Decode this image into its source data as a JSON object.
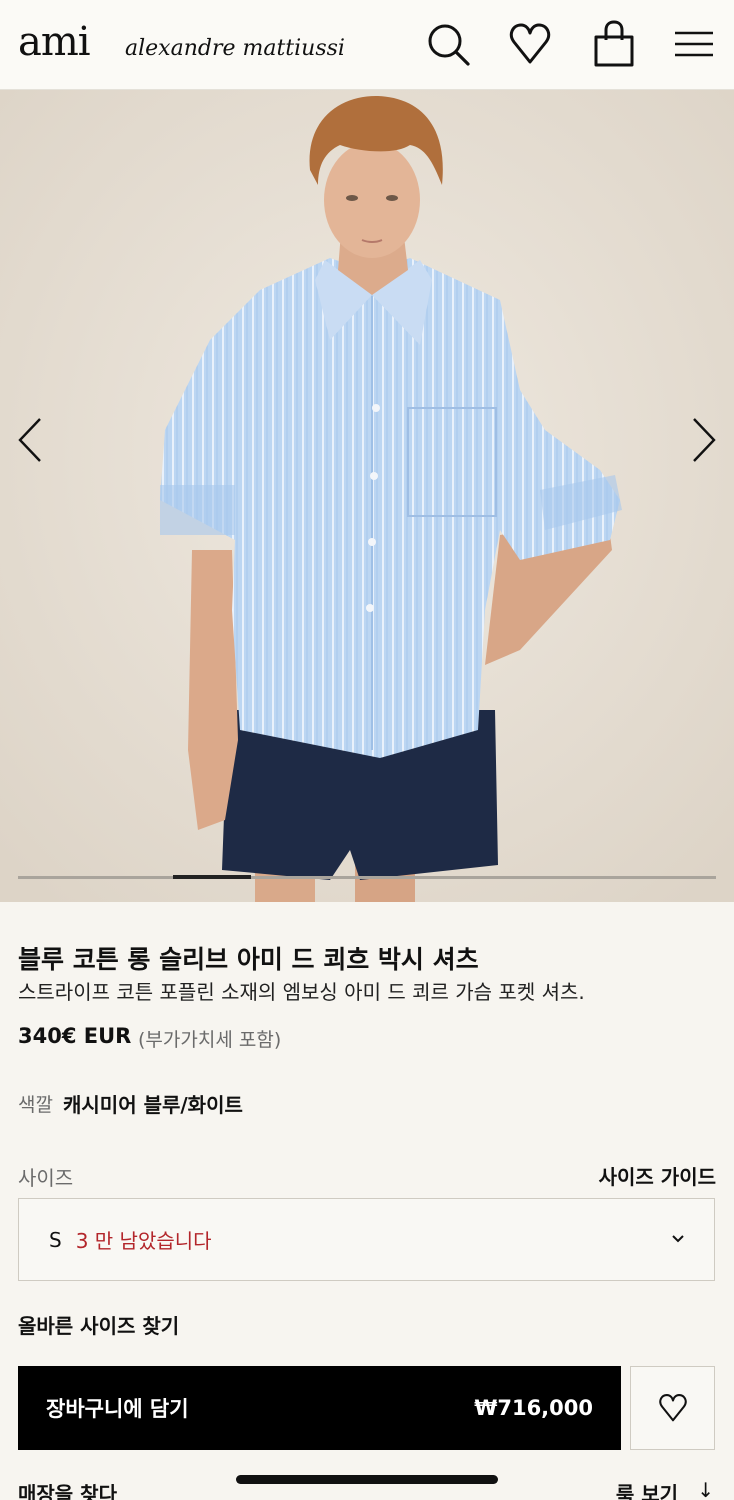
{
  "header": {
    "logo_main": "ami",
    "logo_sub": "alexandre mattiussi",
    "icons": [
      "search-icon",
      "heart-icon",
      "bag-icon",
      "menu-icon"
    ]
  },
  "gallery": {
    "prev_icon": "chevron-left-icon",
    "next_icon": "chevron-right-icon",
    "current_index": 3,
    "total_images": 9
  },
  "product": {
    "title": "블루 코튼 롱 슬리브 아미 드 쾨흐 박시 셔츠",
    "description": "스트라이프 코튼 포플린 소재의 엠보싱 아미 드 쾨르 가슴 포켓 셔츠.",
    "price": "340€ EUR",
    "price_note": "(부가가치세 포함)",
    "color_label": "색깔",
    "color_value": "캐시미어 블루/화이트",
    "size_label": "사이즈",
    "size_guide_label": "사이즈 가이드",
    "selected_size": "S",
    "stock_note": "3 만 남았습니다",
    "find_size_label": "올바른 사이즈 찾기",
    "add_to_cart_label": "장바구니에 담기",
    "add_to_cart_price": "₩716,000",
    "find_store_label": "매장을 찾다",
    "look_label": "룩 보기",
    "look_arrow": "↓"
  },
  "colors": {
    "stock_warning": "#b3262b",
    "primary_button": "#000000",
    "background": "#f7f5f0"
  }
}
